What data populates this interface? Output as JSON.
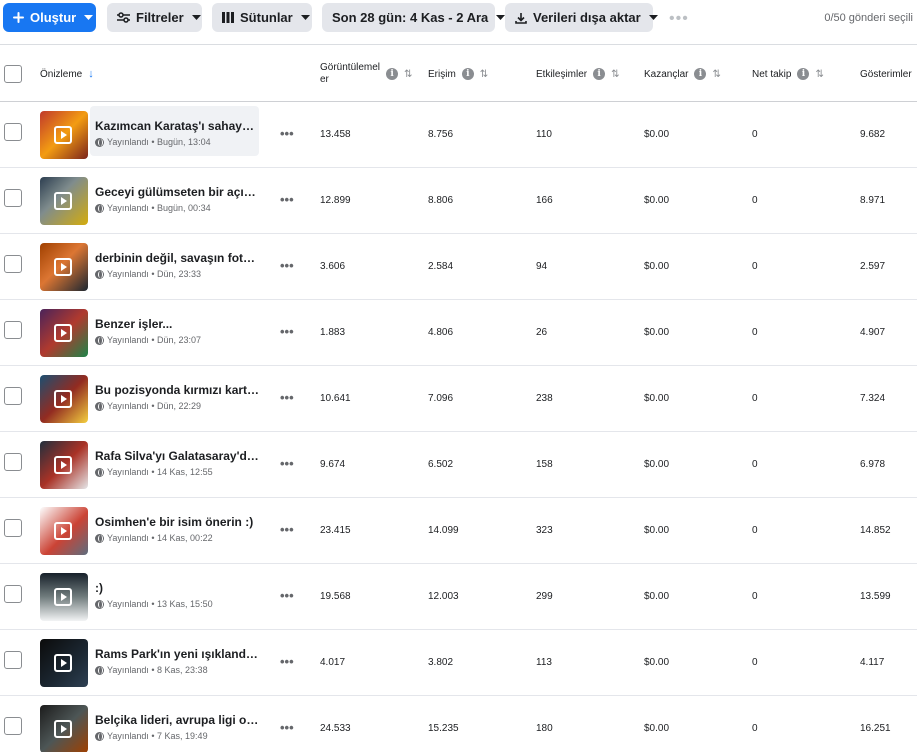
{
  "toolbar": {
    "create_label": "Oluştur",
    "filters_label": "Filtreler",
    "columns_label": "Sütunlar",
    "date_range_label": "Son 28 gün: 4 Kas - 2 Ara",
    "export_label": "Verileri dışa aktar",
    "post_count": "0/50 gönderi seçili"
  },
  "columns": {
    "preview": "Önizleme",
    "views_line1": "Görüntülemel",
    "views_line2": "er",
    "reach": "Erişim",
    "interactions": "Etkileşimler",
    "earnings": "Kazançlar",
    "net_follows": "Net takip",
    "impressions": "Gösterimler"
  },
  "status_label": "Yayınlandı",
  "rows": [
    {
      "title": "Kazımcan Karataş'ı sahaya a...",
      "date": "Bugün, 13:04",
      "views": "13.458",
      "reach": "8.756",
      "interactions": "110",
      "earnings": "$0.00",
      "net": "0",
      "impressions": "9.682"
    },
    {
      "title": "Geceyi gülümseten bir açıkl...",
      "date": "Bugün, 00:34",
      "views": "12.899",
      "reach": "8.806",
      "interactions": "166",
      "earnings": "$0.00",
      "net": "0",
      "impressions": "8.971"
    },
    {
      "title": "derbinin değil, savaşın fotoğ...",
      "date": "Dün, 23:33",
      "views": "3.606",
      "reach": "2.584",
      "interactions": "94",
      "earnings": "$0.00",
      "net": "0",
      "impressions": "2.597"
    },
    {
      "title": "Benzer işler...",
      "date": "Dün, 23:07",
      "views": "1.883",
      "reach": "4.806",
      "interactions": "26",
      "earnings": "$0.00",
      "net": "0",
      "impressions": "4.907"
    },
    {
      "title": "Bu pozisyonda kırmızı kart v...",
      "date": "Dün, 22:29",
      "views": "10.641",
      "reach": "7.096",
      "interactions": "238",
      "earnings": "$0.00",
      "net": "0",
      "impressions": "7.324"
    },
    {
      "title": "Rafa Silva'yı Galatasaray'da ...",
      "date": "14 Kas, 12:55",
      "views": "9.674",
      "reach": "6.502",
      "interactions": "158",
      "earnings": "$0.00",
      "net": "0",
      "impressions": "6.978"
    },
    {
      "title": "Osimhen'e bir isim önerin :)",
      "date": "14 Kas, 00:22",
      "views": "23.415",
      "reach": "14.099",
      "interactions": "323",
      "earnings": "$0.00",
      "net": "0",
      "impressions": "14.852"
    },
    {
      "title": ":)",
      "date": "13 Kas, 15:50",
      "views": "19.568",
      "reach": "12.003",
      "interactions": "299",
      "earnings": "$0.00",
      "net": "0",
      "impressions": "13.599"
    },
    {
      "title": "Rams Park'ın yeni ışıklandır...",
      "date": "8 Kas, 23:38",
      "views": "4.017",
      "reach": "3.802",
      "interactions": "113",
      "earnings": "$0.00",
      "net": "0",
      "impressions": "4.117"
    },
    {
      "title": "Belçika lideri, avrupa ligi on ...",
      "date": "7 Kas, 19:49",
      "views": "24.533",
      "reach": "15.235",
      "interactions": "180",
      "earnings": "$0.00",
      "net": "0",
      "impressions": "16.251"
    }
  ],
  "colors": {
    "accent": "#1877f2",
    "button_bg": "#e4e6eb",
    "text": "#1c1e21",
    "muted": "#65676b"
  },
  "icons": {
    "create": "plus-icon",
    "filters": "sliders-icon",
    "columns": "columns-icon",
    "export": "download-icon",
    "status": "globe-icon",
    "row_actions": "more-horizontal-icon",
    "info": "info-icon",
    "sort": "sort-icon"
  }
}
